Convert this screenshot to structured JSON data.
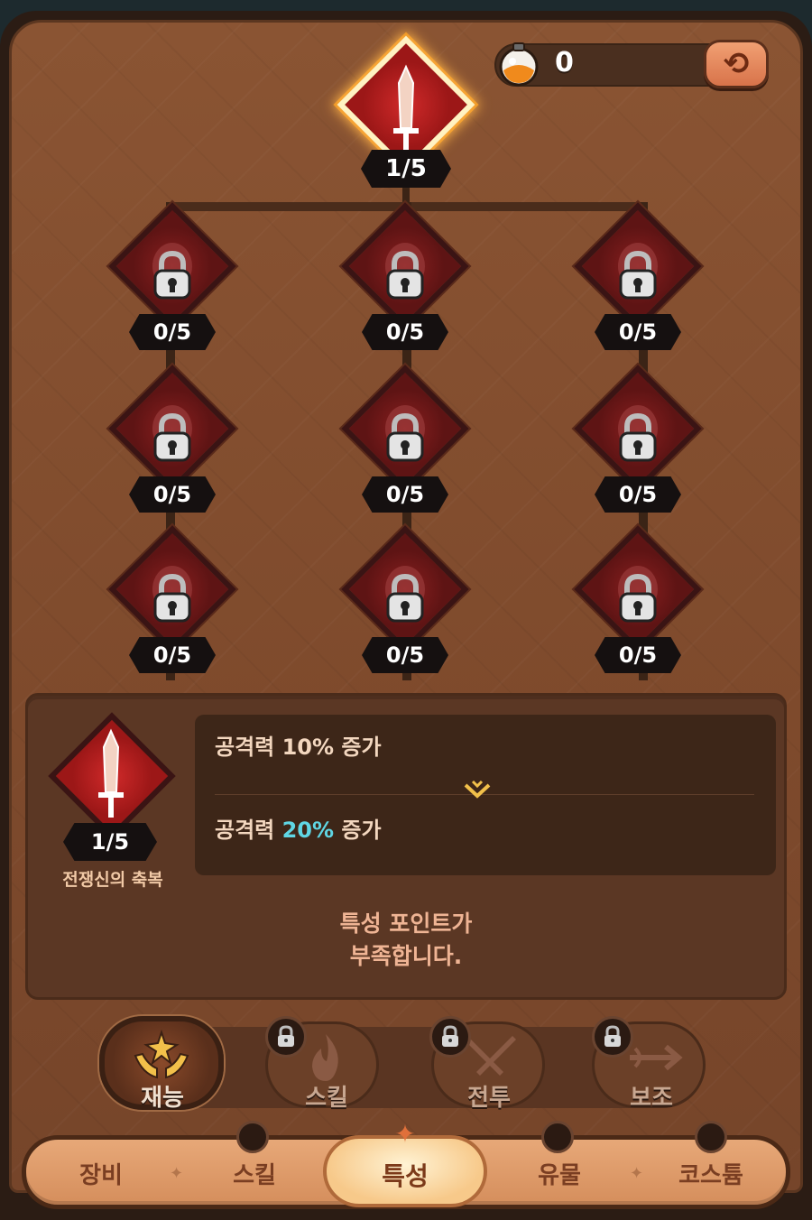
{
  "currency": {
    "icon": "potion-flask-icon",
    "value": "0"
  },
  "reset_button": {
    "icon": "refresh-icon",
    "glyph": "⟲"
  },
  "top_node": {
    "icon": "sword-icon",
    "level": "1/5"
  },
  "tree_nodes": [
    {
      "level": "0/5",
      "locked": true
    },
    {
      "level": "0/5",
      "locked": true
    },
    {
      "level": "0/5",
      "locked": true
    },
    {
      "level": "0/5",
      "locked": true
    },
    {
      "level": "0/5",
      "locked": true
    },
    {
      "level": "0/5",
      "locked": true
    },
    {
      "level": "0/5",
      "locked": true
    },
    {
      "level": "0/5",
      "locked": true
    },
    {
      "level": "0/5",
      "locked": true
    }
  ],
  "detail": {
    "level": "1/5",
    "name": "전쟁신의 축복",
    "current_prefix": "공격력 ",
    "current_value": "10%",
    "current_suffix": " 증가",
    "next_prefix": "공격력 ",
    "next_value": "20%",
    "next_suffix": " 증가",
    "warning_line1": "특성 포인트가",
    "warning_line2": "부족합니다.",
    "highlight_color": "#5fd6e4"
  },
  "categories": [
    {
      "label": "재능",
      "active": true,
      "locked": false,
      "icon": "hands-star-icon"
    },
    {
      "label": "스킬",
      "active": false,
      "locked": true,
      "icon": "flame-icon"
    },
    {
      "label": "전투",
      "active": false,
      "locked": true,
      "icon": "crossed-swords-icon"
    },
    {
      "label": "보조",
      "active": false,
      "locked": true,
      "icon": "winged-arrow-icon"
    }
  ],
  "nav": {
    "items": [
      {
        "label": "장비",
        "locked": false
      },
      {
        "label": "스킬",
        "locked": true
      },
      {
        "label": "특성",
        "locked": false,
        "active": true
      },
      {
        "label": "유물",
        "locked": true
      },
      {
        "label": "코스튬",
        "locked": true
      }
    ]
  }
}
